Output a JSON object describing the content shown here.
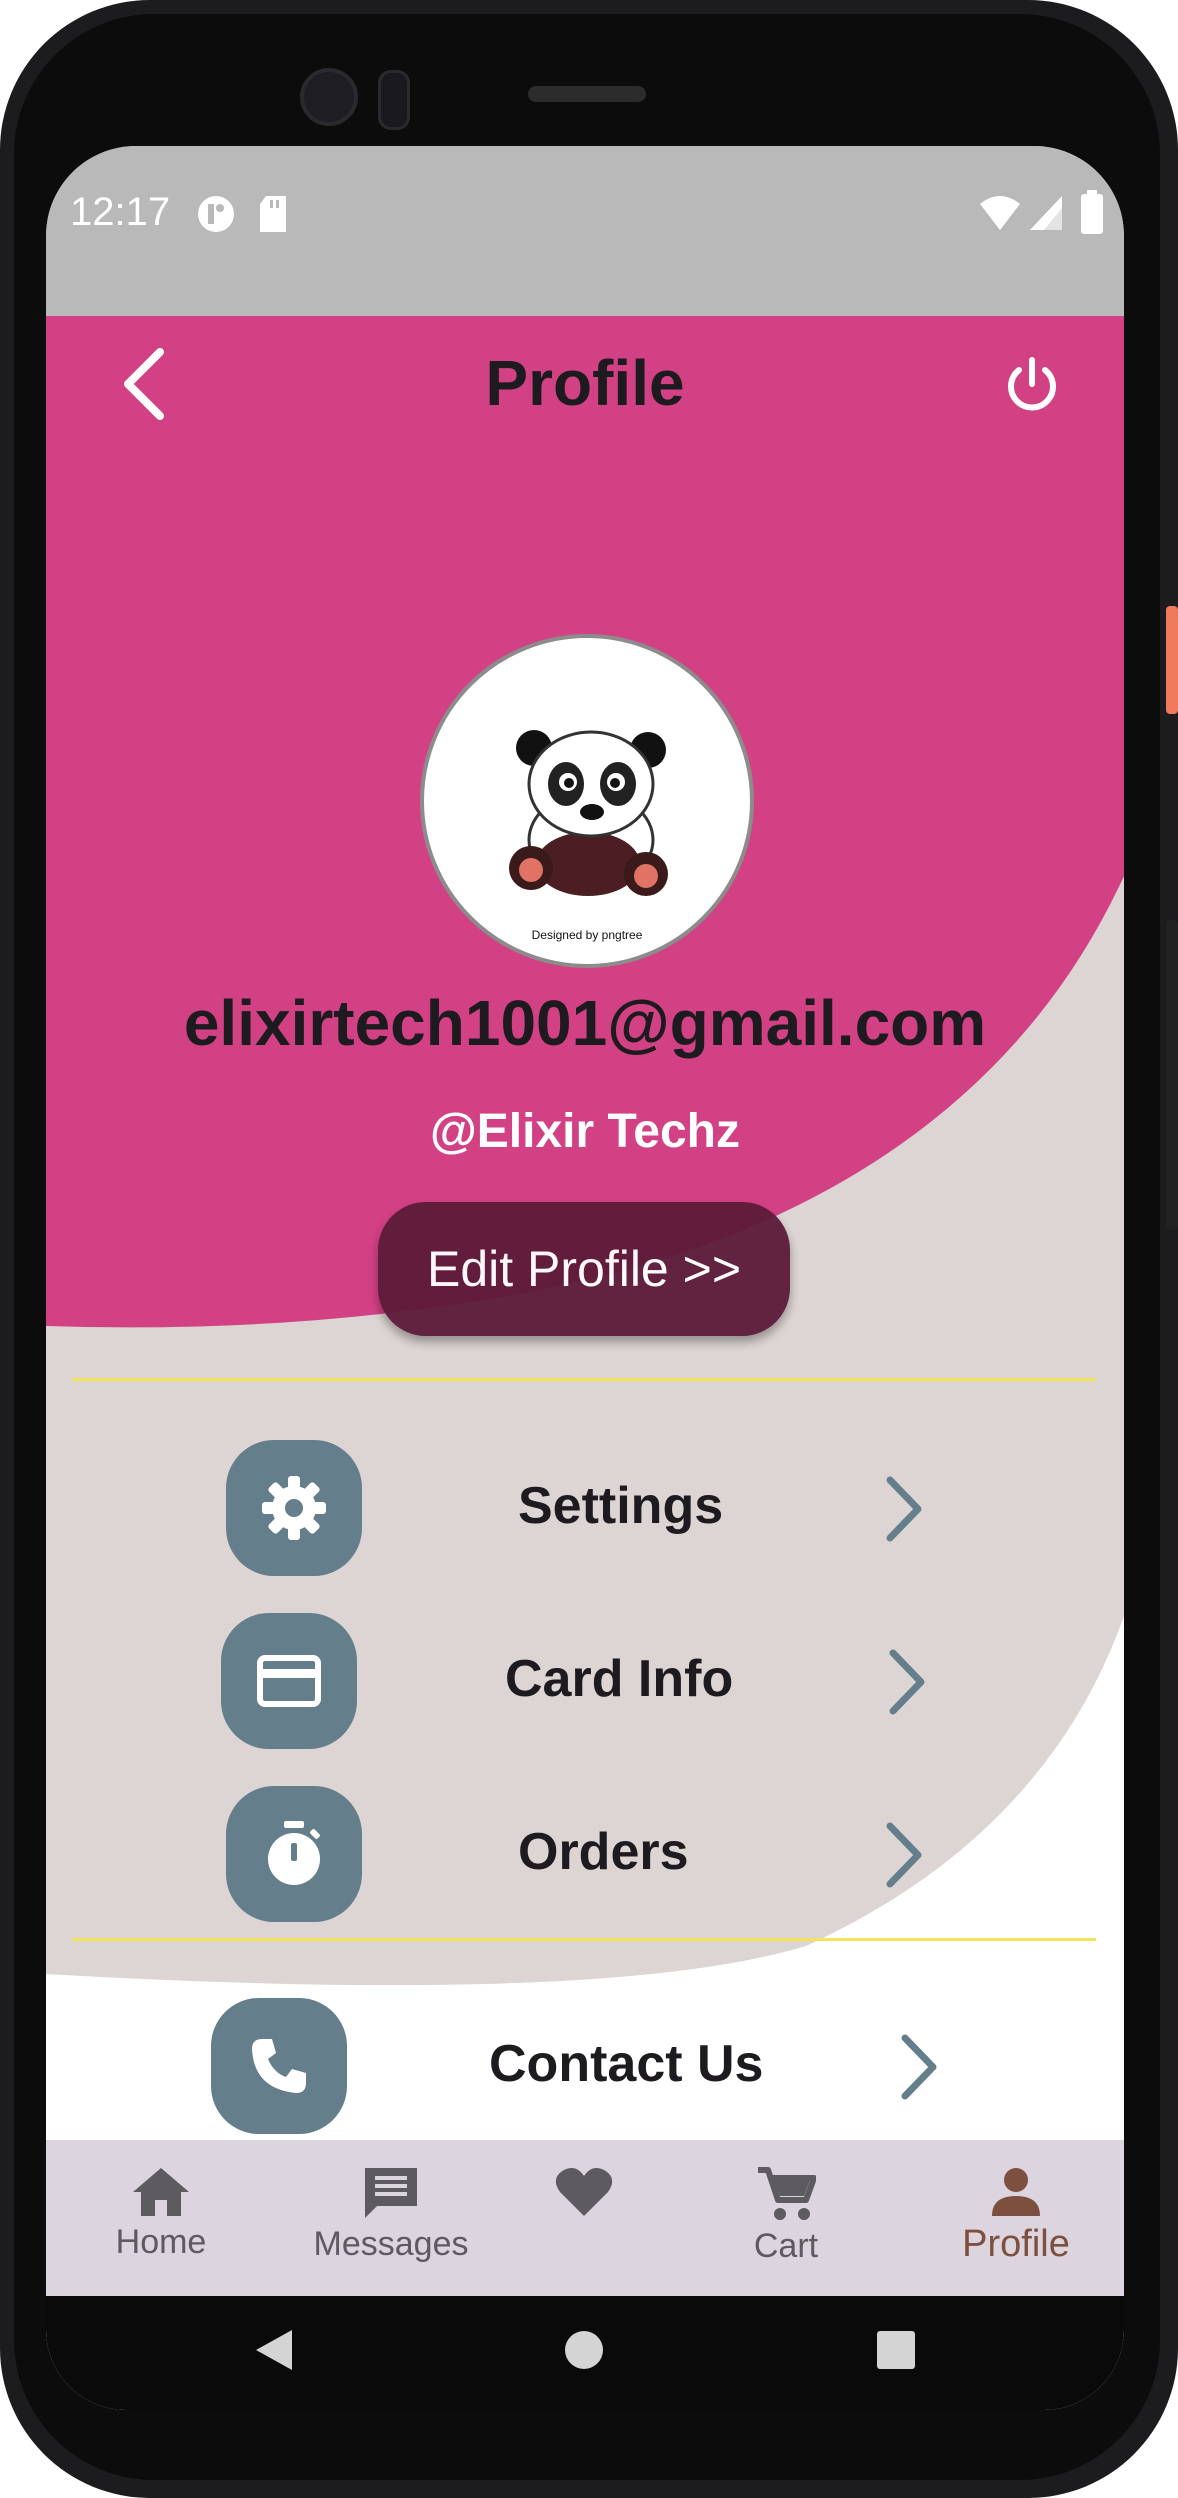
{
  "status_bar": {
    "time": "12:17"
  },
  "header": {
    "title": "Profile"
  },
  "profile": {
    "avatar_caption": "Designed by pngtree",
    "email": "elixirtech1001@gmail.com",
    "handle": "@Elixir Techz",
    "edit_button": "Edit Profile >>"
  },
  "menu": {
    "items": [
      {
        "label": "Settings",
        "icon": "gear-icon"
      },
      {
        "label": "Card Info",
        "icon": "credit-card-icon"
      },
      {
        "label": "Orders",
        "icon": "stopwatch-icon"
      },
      {
        "label": "Contact Us",
        "icon": "phone-icon"
      }
    ]
  },
  "bottom_nav": {
    "items": [
      {
        "label": "Home",
        "icon": "home-icon"
      },
      {
        "label": "Messages",
        "icon": "message-icon"
      },
      {
        "label": "",
        "icon": "heart-icon"
      },
      {
        "label": "Cart",
        "icon": "cart-icon"
      },
      {
        "label": "Profile",
        "icon": "person-icon",
        "active": true
      }
    ]
  },
  "colors": {
    "header_pink": "#d34185",
    "blob_grey": "#dcd5d3",
    "icon_slate": "#647e8b",
    "button_maroon": "#5e1c3b",
    "divider_yellow": "#f3e45a",
    "nav_active": "#7c4f3f"
  }
}
